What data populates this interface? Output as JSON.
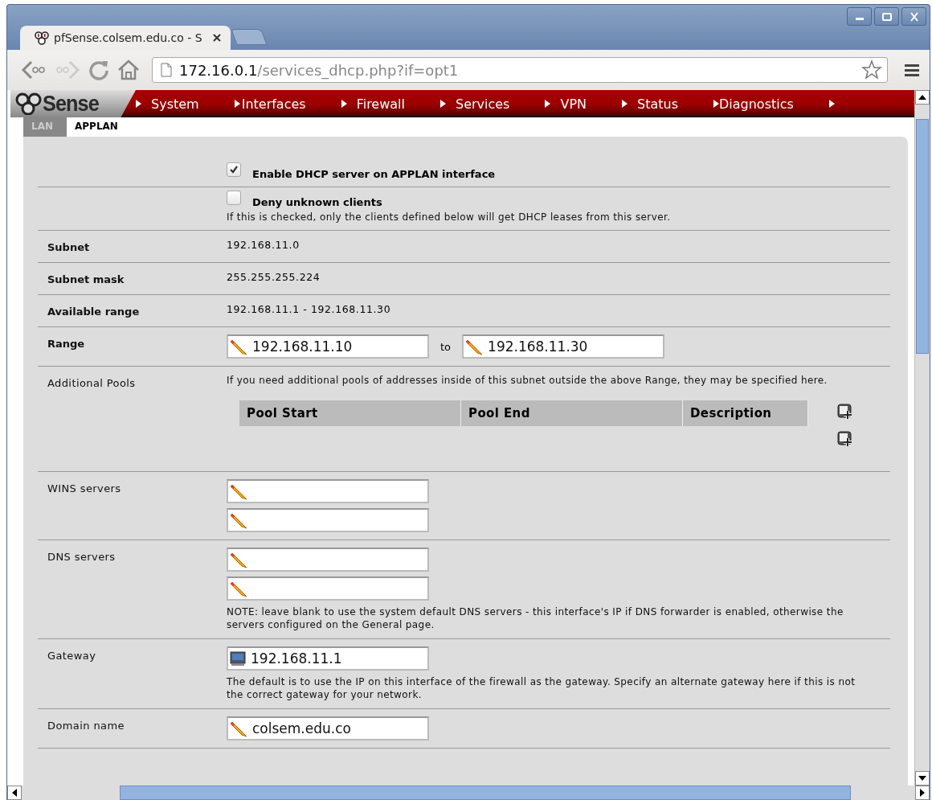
{
  "window": {
    "tab_title": "pfSense.colsem.edu.co - S",
    "url_host": "172.16.0.1",
    "url_path": "/services_dhcp.php?if=opt1"
  },
  "logo": "Sense",
  "nav": [
    "System",
    "Interfaces",
    "Firewall",
    "Services",
    "VPN",
    "Status",
    "Diagnostics"
  ],
  "tabs": [
    {
      "label": "LAN",
      "selected": false
    },
    {
      "label": "APPLAN",
      "selected": true
    }
  ],
  "rows": [
    {
      "kind": "checkbox",
      "checked": true,
      "text": "Enable DHCP server on APPLAN interface"
    },
    {
      "kind": "checkbox",
      "checked": false,
      "text": "Deny unknown clients",
      "note": "If this is checked, only the clients defined below will get DHCP leases from this server."
    },
    {
      "kind": "info",
      "label": "Subnet",
      "required": true,
      "value": "192.168.11.0"
    },
    {
      "kind": "info",
      "label": "Subnet mask",
      "required": true,
      "value": "255.255.255.224"
    },
    {
      "kind": "info",
      "label": "Available range",
      "required": true,
      "value": "192.168.11.1 - 192.168.11.30"
    },
    {
      "kind": "range",
      "label": "Range",
      "required": true,
      "from": "192.168.11.10",
      "joiner": "to",
      "to": "192.168.11.30"
    },
    {
      "kind": "pools",
      "label": "Additional Pools",
      "required": false,
      "note": "If you need additional pools of addresses inside of this subnet outside the above Range, they may be specified here.",
      "columns": [
        "Pool Start",
        "Pool End",
        "Description"
      ]
    },
    {
      "kind": "inputs",
      "label": "WINS servers",
      "required": false,
      "fields": [
        {
          "kind": "edit"
        },
        {
          "kind": "edit"
        }
      ]
    },
    {
      "kind": "inputs",
      "label": "DNS servers",
      "required": false,
      "fields": [
        {
          "kind": "edit"
        },
        {
          "kind": "edit"
        }
      ],
      "note": "NOTE: leave blank to use the system default DNS servers - this interface's IP if DNS forwarder is enabled, otherwise the servers configured on the General page."
    },
    {
      "kind": "inputs",
      "label": "Gateway",
      "required": false,
      "fields": [
        {
          "kind": "gateway",
          "value": "192.168.11.1"
        }
      ],
      "note": "The default is to use the IP on this interface of the firewall as the gateway. Specify an alternate gateway here if this is not the correct gateway for your network."
    },
    {
      "kind": "inputs",
      "label": "Domain name",
      "required": false,
      "fields": [
        {
          "kind": "edit",
          "value": "colsem.edu.co"
        }
      ]
    }
  ]
}
